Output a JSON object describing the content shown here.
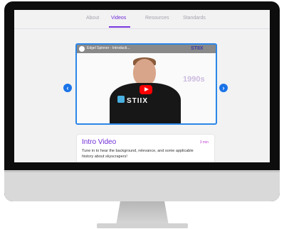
{
  "tabs": [
    {
      "label": "About",
      "active": false
    },
    {
      "label": "Videos",
      "active": true
    },
    {
      "label": "Resources",
      "active": false
    },
    {
      "label": "Standards",
      "active": false
    }
  ],
  "video": {
    "title": "Edgel Spinner - Introducti...",
    "brand": "STIIX",
    "year_overlay": "1990s",
    "shirt_logo": "STIIX",
    "play_icon": "youtube-play-icon"
  },
  "card": {
    "title": "Intro Video",
    "duration": "3 min",
    "description": "Tune in to hear the background, relevance, and some applicable history about skyscrapers!"
  },
  "colors": {
    "accent": "#7a35e0",
    "nav_blue": "#1a73e8",
    "frame_blue": "#2b86e8",
    "duration_pink": "#c03bd6"
  },
  "icons": {
    "prev": "chevron-left-icon",
    "next": "chevron-right-icon"
  }
}
